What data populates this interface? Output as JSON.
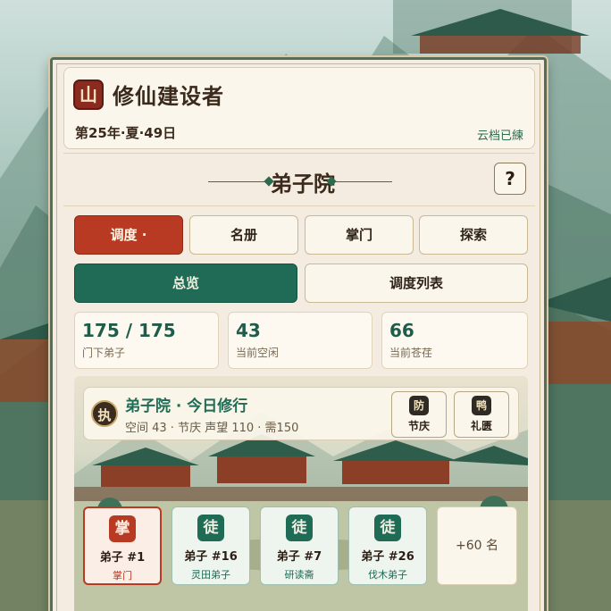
{
  "header": {
    "logo_glyph": "山",
    "app_title": "修仙建设者",
    "date": "第25年·夏·49日",
    "cloud_status": "云档已練"
  },
  "page": {
    "title": "弟子院",
    "help_label": "?"
  },
  "tabs": [
    {
      "label": "调度 ·",
      "active": true
    },
    {
      "label": "名册",
      "active": false
    },
    {
      "label": "掌门",
      "active": false
    },
    {
      "label": "探索",
      "active": false
    }
  ],
  "subtabs": [
    {
      "label": "总览",
      "active": true
    },
    {
      "label": "调度列表",
      "active": false
    }
  ],
  "stats": [
    {
      "value": "175 / 175",
      "label": "门下弟子"
    },
    {
      "value": "43",
      "label": "当前空闲"
    },
    {
      "value": "66",
      "label": "当前苍荏"
    }
  ],
  "scene": {
    "icon_glyph": "执",
    "title": "弟子院 · 今日修行",
    "subtitle": "空间 43 · 节庆 声望 110 · 需150",
    "actions": [
      {
        "icon": "防",
        "label": "节庆"
      },
      {
        "icon": "鸭",
        "label": "礼匮"
      }
    ]
  },
  "disciples": [
    {
      "badge": "掌",
      "name": "弟子 #1",
      "role": "掌门"
    },
    {
      "badge": "徒",
      "name": "弟子 #16",
      "role": "灵田弟子"
    },
    {
      "badge": "徒",
      "name": "弟子 #7",
      "role": "研读斋"
    },
    {
      "badge": "徒",
      "name": "弟子 #26",
      "role": "伐木弟子"
    }
  ],
  "more_label": "+60 名",
  "colors": {
    "accent_red": "#b93a22",
    "accent_green": "#1f6b55",
    "panel_bg": "#f4ece0"
  }
}
